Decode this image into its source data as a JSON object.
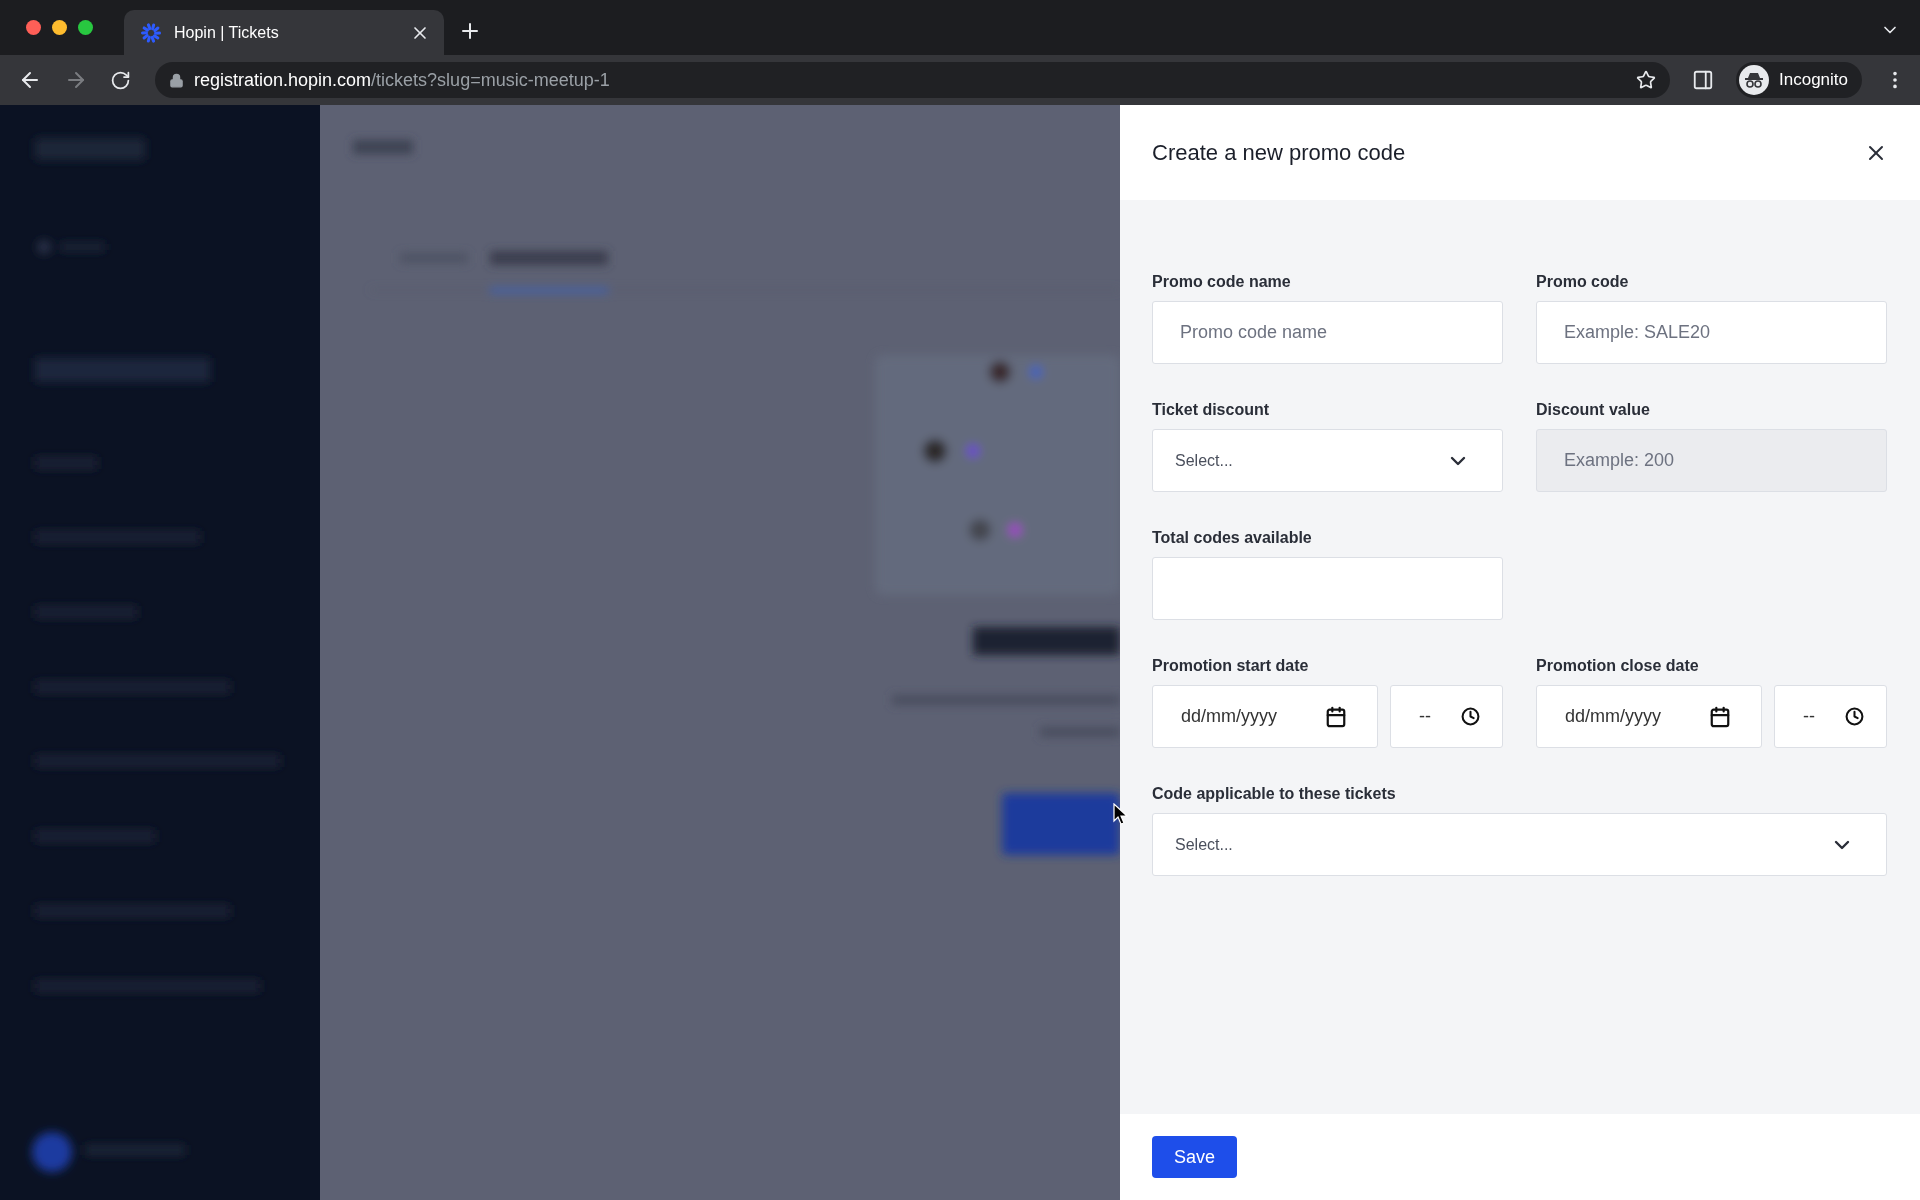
{
  "browser": {
    "tab": {
      "title": "Hopin | Tickets"
    },
    "url": {
      "host": "registration.hopin.com",
      "path": "/tickets?slug=music-meetup-1"
    },
    "profile": "Incognito"
  },
  "panel": {
    "title": "Create a new promo code",
    "rows": [
      [
        {
          "kind": "text",
          "label": "Promo code name",
          "placeholder": "Promo code name",
          "disabled": false
        },
        {
          "kind": "text",
          "label": "Promo code",
          "placeholder": "Example: SALE20",
          "disabled": false
        }
      ],
      [
        {
          "kind": "select",
          "label": "Ticket discount",
          "placeholder": "Select..."
        },
        {
          "kind": "text",
          "label": "Discount value",
          "placeholder": "Example: 200",
          "disabled": true
        }
      ],
      [
        {
          "kind": "text",
          "label": "Total codes available",
          "disabled": false
        }
      ],
      [
        {
          "kind": "datetime",
          "label": "Promotion start date",
          "date_placeholder": "dd/mm/yyyy",
          "time_placeholder": "--"
        },
        {
          "kind": "datetime",
          "label": "Promotion close date",
          "date_placeholder": "dd/mm/yyyy",
          "time_placeholder": "--"
        }
      ]
    ],
    "applicable_tickets": {
      "kind": "select",
      "label": "Code applicable to these tickets",
      "placeholder": "Select..."
    },
    "save_button": "Save"
  }
}
